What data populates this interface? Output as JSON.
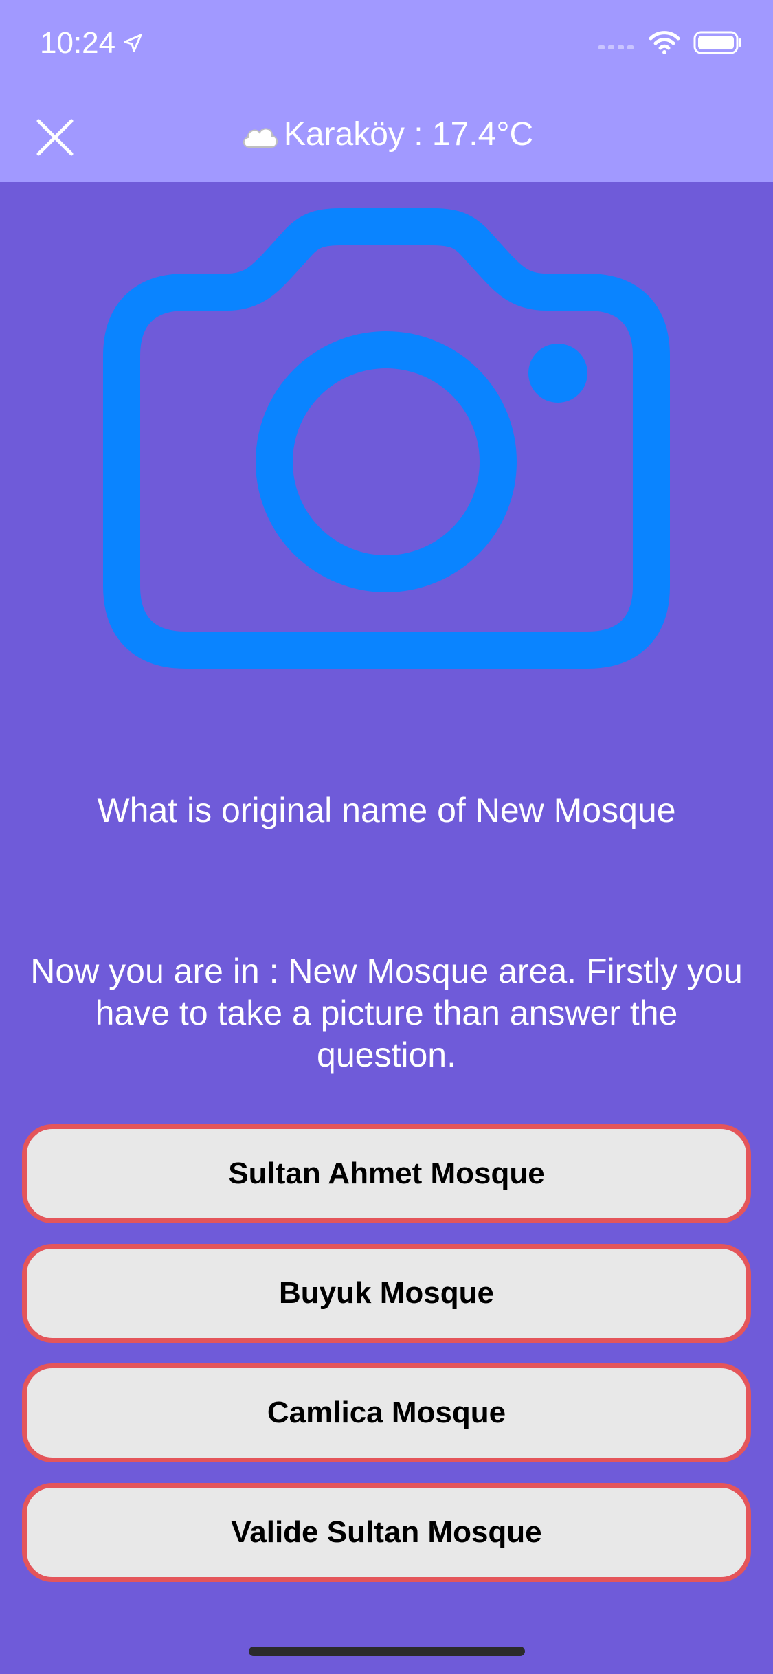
{
  "status_bar": {
    "time": "10:24",
    "icons": [
      "location-arrow-icon",
      "cellular-signal-icon",
      "wifi-icon",
      "battery-icon"
    ]
  },
  "nav": {
    "close_icon": "close-icon",
    "weather_icon": "cloud-icon",
    "title": "Karaköy : 17.4°C"
  },
  "camera": {
    "icon": "camera-icon",
    "color": "#0a84ff"
  },
  "question": "What is original name of New Mosque",
  "instruction": "Now you are in : New Mosque area. Firstly you have to take a picture than answer the question.",
  "answers": [
    "Sultan Ahmet Mosque",
    "Buyuk Mosque",
    "Camlica Mosque",
    "Valide Sultan Mosque"
  ],
  "colors": {
    "background": "#6f5bd9",
    "header": "#a199ff",
    "answer_border": "#e4555a",
    "answer_fill": "#e8e8e8"
  }
}
